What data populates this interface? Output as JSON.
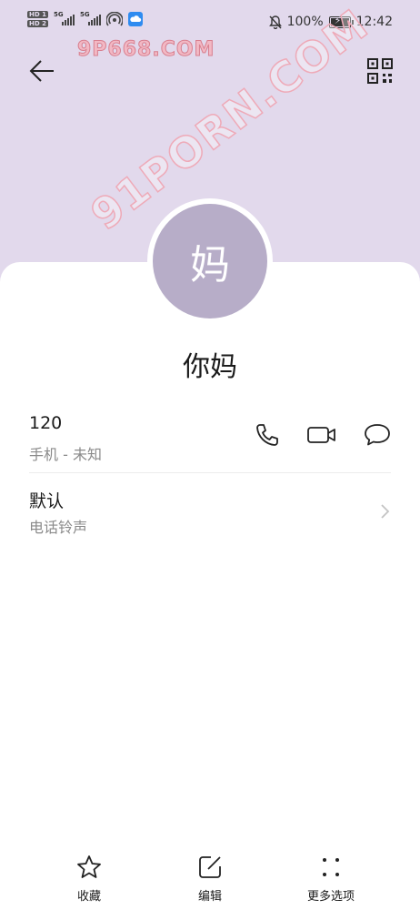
{
  "status_bar": {
    "hd1": "HD 1",
    "hd2": "HD 2",
    "sig1_gen": "5G",
    "sig2_gen": "5G",
    "battery_percent": "100%",
    "time": "12:42"
  },
  "header": {
    "watermark_top": "9P668.COM",
    "watermark_diag": "91PORN.COM"
  },
  "contact": {
    "avatar_char": "妈",
    "name": "你妈"
  },
  "phone": {
    "number": "120",
    "type": "手机 - 未知"
  },
  "ringtone": {
    "value": "默认",
    "label": "电话铃声"
  },
  "bottom_bar": {
    "favorite_label": "收藏",
    "edit_label": "编辑",
    "more_label": "更多选项"
  },
  "colors": {
    "header_bg": "#e2d9ec",
    "avatar_bg": "#b7adc8",
    "secondary_text": "#8a8a8a"
  }
}
